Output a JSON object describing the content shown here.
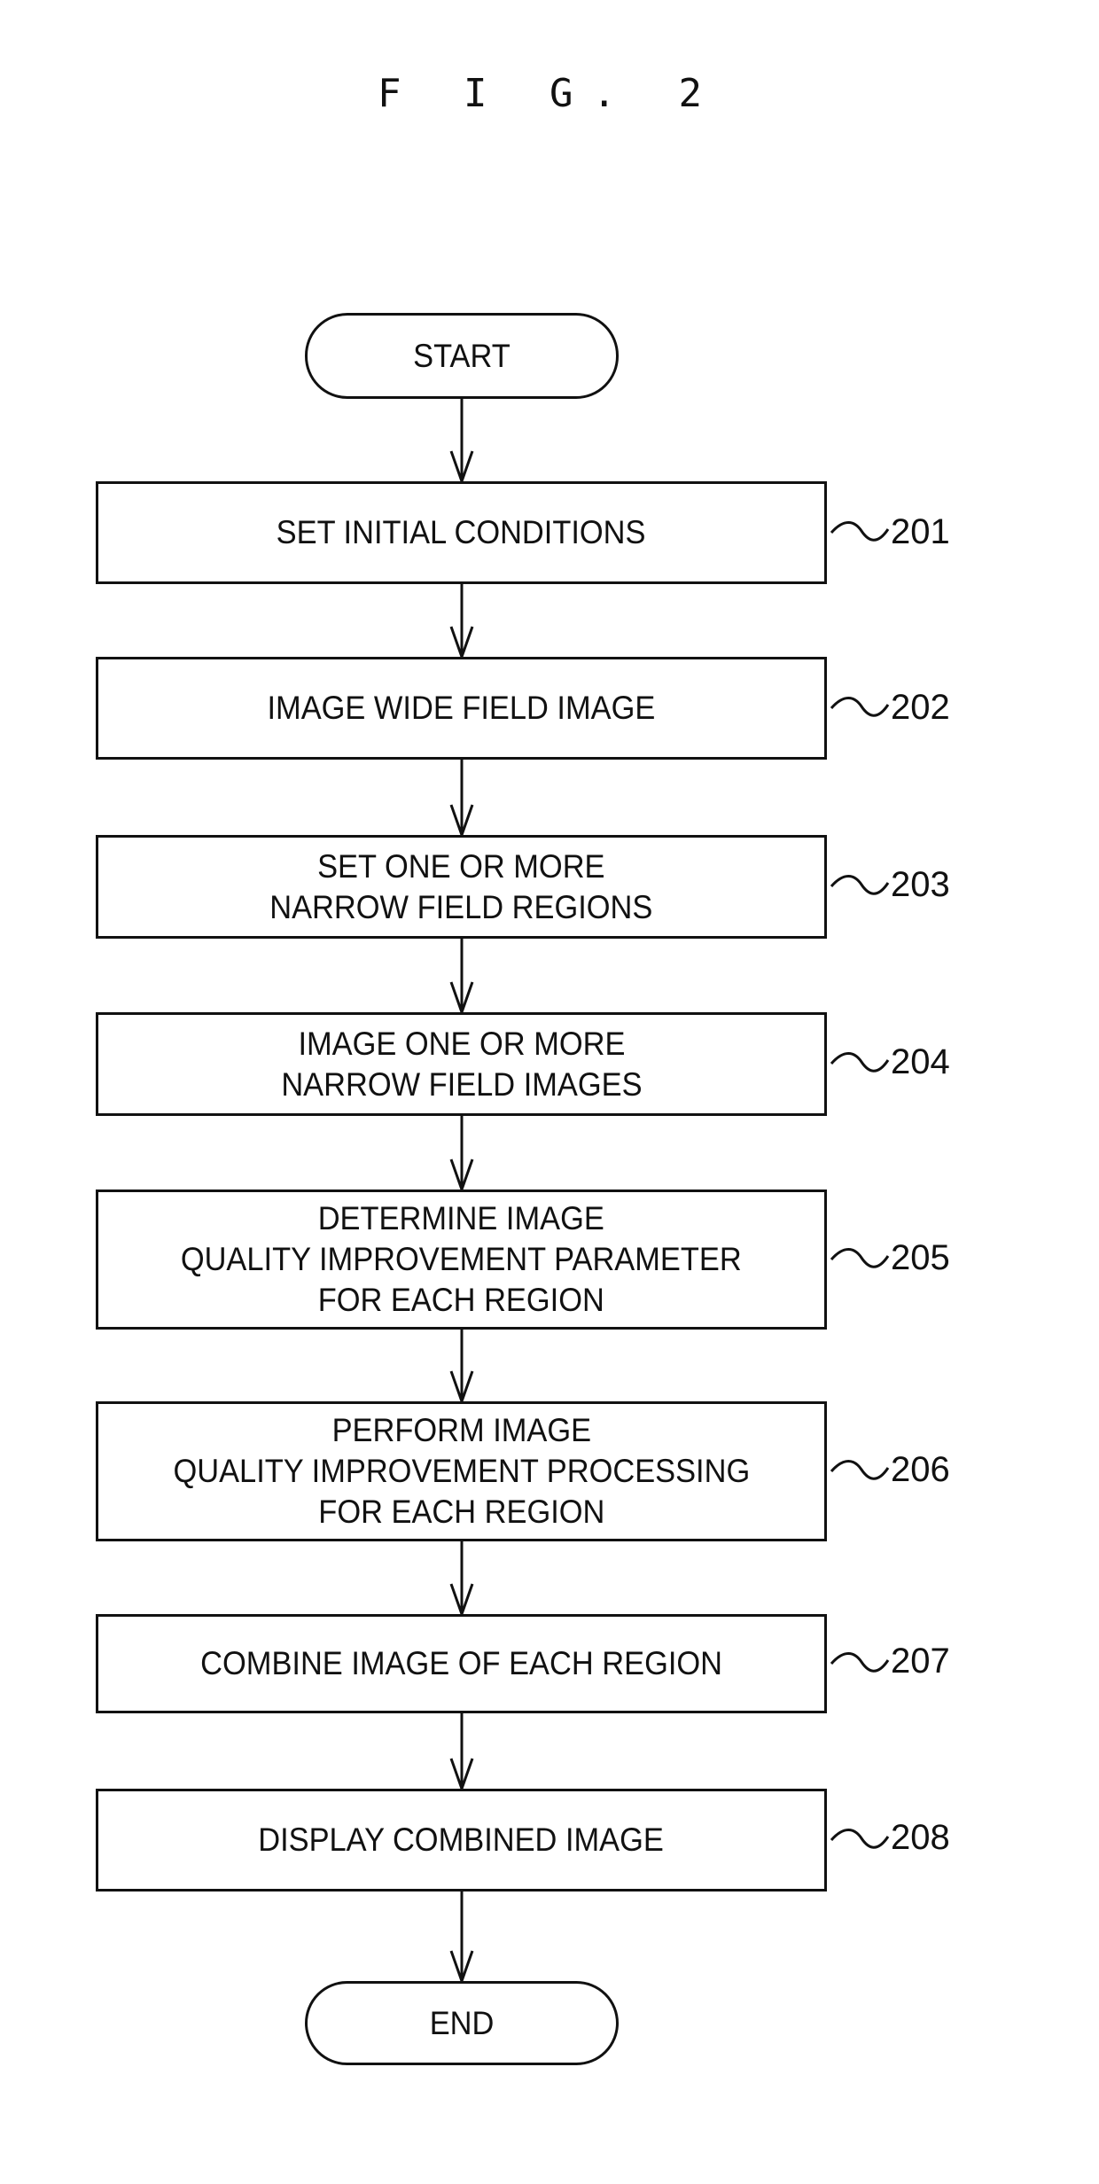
{
  "figure": {
    "title": "F I G. 2"
  },
  "start": {
    "label": "START"
  },
  "end": {
    "label": "END"
  },
  "steps": [
    {
      "ref": "201",
      "label": "SET INITIAL CONDITIONS"
    },
    {
      "ref": "202",
      "label": "IMAGE WIDE FIELD IMAGE"
    },
    {
      "ref": "203",
      "label": "SET ONE OR MORE\nNARROW FIELD REGIONS"
    },
    {
      "ref": "204",
      "label": "IMAGE ONE OR MORE\nNARROW FIELD IMAGES"
    },
    {
      "ref": "205",
      "label": "DETERMINE IMAGE\nQUALITY IMPROVEMENT PARAMETER\nFOR EACH REGION"
    },
    {
      "ref": "206",
      "label": "PERFORM IMAGE\nQUALITY IMPROVEMENT PROCESSING\nFOR EACH REGION"
    },
    {
      "ref": "207",
      "label": "COMBINE IMAGE OF EACH REGION"
    },
    {
      "ref": "208",
      "label": "DISPLAY COMBINED IMAGE"
    }
  ]
}
